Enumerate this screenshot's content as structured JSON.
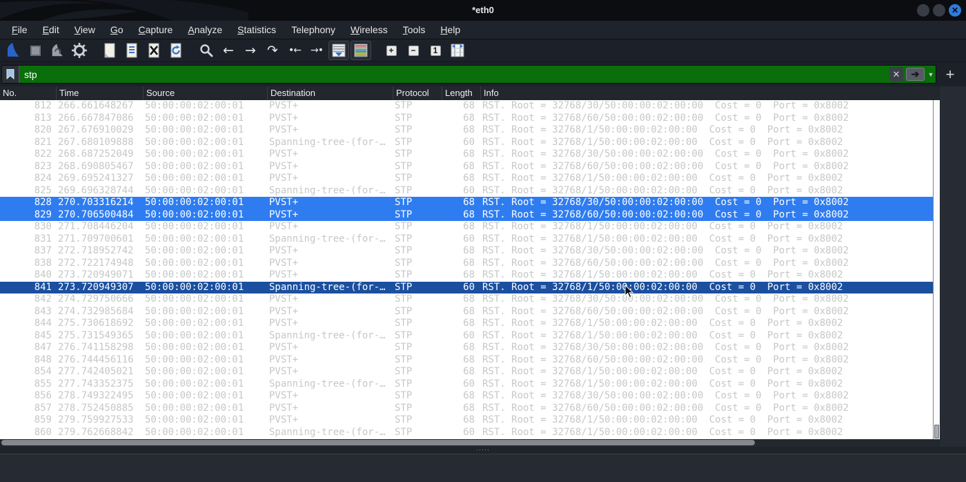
{
  "window": {
    "title": "*eth0",
    "controls": {
      "minimize": "",
      "maximize": "",
      "close": "✕"
    }
  },
  "menu_bar": {
    "items": [
      {
        "label": "File",
        "mnemonic": "F"
      },
      {
        "label": "Edit",
        "mnemonic": "E"
      },
      {
        "label": "View",
        "mnemonic": "V"
      },
      {
        "label": "Go",
        "mnemonic": "G"
      },
      {
        "label": "Capture",
        "mnemonic": "C"
      },
      {
        "label": "Analyze",
        "mnemonic": "A"
      },
      {
        "label": "Statistics",
        "mnemonic": "S"
      },
      {
        "label": "Telephony",
        "mnemonic": ""
      },
      {
        "label": "Wireless",
        "mnemonic": "W"
      },
      {
        "label": "Tools",
        "mnemonic": "T"
      },
      {
        "label": "Help",
        "mnemonic": "H"
      }
    ]
  },
  "toolbar": {
    "buttons": [
      {
        "name": "start-capture"
      },
      {
        "name": "stop-capture"
      },
      {
        "name": "restart-capture"
      },
      {
        "name": "capture-options"
      },
      {
        "name": "open-file"
      },
      {
        "name": "save-file"
      },
      {
        "name": "close-file"
      },
      {
        "name": "reload-file"
      },
      {
        "name": "find-packet"
      },
      {
        "name": "go-back",
        "glyph": "←"
      },
      {
        "name": "go-forward",
        "glyph": "→"
      },
      {
        "name": "go-to-packet",
        "glyph": "↷"
      },
      {
        "name": "go-first-packet",
        "glyph": "•←"
      },
      {
        "name": "go-last-packet",
        "glyph": "→•"
      },
      {
        "name": "auto-scroll",
        "pressed": true
      },
      {
        "name": "colorize",
        "pressed": true
      },
      {
        "name": "zoom-in",
        "glyph": "+"
      },
      {
        "name": "zoom-out",
        "glyph": "−"
      },
      {
        "name": "zoom-normal",
        "glyph": "1"
      },
      {
        "name": "resize-columns"
      }
    ]
  },
  "filter_bar": {
    "value": "stp",
    "bookmark_icon": "bookmark-icon",
    "clear_label": "✕",
    "apply_label": "➔",
    "dropdown_caret": "▼",
    "add_button_label": "+"
  },
  "packet_list": {
    "columns": [
      "No.",
      "Time",
      "Source",
      "Destination",
      "Protocol",
      "Length",
      "Info"
    ],
    "rows": [
      {
        "state": "normal",
        "no": "812",
        "time": "266.661648267",
        "source": "50:00:00:02:00:01",
        "destination": "PVST+",
        "protocol": "STP",
        "length": "68",
        "info": "RST. Root = 32768/30/50:00:00:02:00:00  Cost = 0  Port = 0x8002"
      },
      {
        "state": "normal",
        "no": "813",
        "time": "266.667847086",
        "source": "50:00:00:02:00:01",
        "destination": "PVST+",
        "protocol": "STP",
        "length": "68",
        "info": "RST. Root = 32768/60/50:00:00:02:00:00  Cost = 0  Port = 0x8002"
      },
      {
        "state": "normal",
        "no": "820",
        "time": "267.676910029",
        "source": "50:00:00:02:00:01",
        "destination": "PVST+",
        "protocol": "STP",
        "length": "68",
        "info": "RST. Root = 32768/1/50:00:00:02:00:00  Cost = 0  Port = 0x8002"
      },
      {
        "state": "normal",
        "no": "821",
        "time": "267.680109888",
        "source": "50:00:00:02:00:01",
        "destination": "Spanning-tree-(for-…",
        "protocol": "STP",
        "length": "60",
        "info": "RST. Root = 32768/1/50:00:00:02:00:00  Cost = 0  Port = 0x8002"
      },
      {
        "state": "normal",
        "no": "822",
        "time": "268.687252049",
        "source": "50:00:00:02:00:01",
        "destination": "PVST+",
        "protocol": "STP",
        "length": "68",
        "info": "RST. Root = 32768/30/50:00:00:02:00:00  Cost = 0  Port = 0x8002"
      },
      {
        "state": "normal",
        "no": "823",
        "time": "268.690805467",
        "source": "50:00:00:02:00:01",
        "destination": "PVST+",
        "protocol": "STP",
        "length": "68",
        "info": "RST. Root = 32768/60/50:00:00:02:00:00  Cost = 0  Port = 0x8002"
      },
      {
        "state": "normal",
        "no": "824",
        "time": "269.695241327",
        "source": "50:00:00:02:00:01",
        "destination": "PVST+",
        "protocol": "STP",
        "length": "68",
        "info": "RST. Root = 32768/1/50:00:00:02:00:00  Cost = 0  Port = 0x8002"
      },
      {
        "state": "normal",
        "no": "825",
        "time": "269.696328744",
        "source": "50:00:00:02:00:01",
        "destination": "Spanning-tree-(for-…",
        "protocol": "STP",
        "length": "60",
        "info": "RST. Root = 32768/1/50:00:00:02:00:00  Cost = 0  Port = 0x8002"
      },
      {
        "state": "selected",
        "no": "828",
        "time": "270.703316214",
        "source": "50:00:00:02:00:01",
        "destination": "PVST+",
        "protocol": "STP",
        "length": "68",
        "info": "RST. Root = 32768/30/50:00:00:02:00:00  Cost = 0  Port = 0x8002"
      },
      {
        "state": "selected",
        "no": "829",
        "time": "270.706500484",
        "source": "50:00:00:02:00:01",
        "destination": "PVST+",
        "protocol": "STP",
        "length": "68",
        "info": "RST. Root = 32768/60/50:00:00:02:00:00  Cost = 0  Port = 0x8002"
      },
      {
        "state": "normal",
        "no": "830",
        "time": "271.708446204",
        "source": "50:00:00:02:00:01",
        "destination": "PVST+",
        "protocol": "STP",
        "length": "68",
        "info": "RST. Root = 32768/1/50:00:00:02:00:00  Cost = 0  Port = 0x8002"
      },
      {
        "state": "normal",
        "no": "831",
        "time": "271.709700601",
        "source": "50:00:00:02:00:01",
        "destination": "Spanning-tree-(for-…",
        "protocol": "STP",
        "length": "60",
        "info": "RST. Root = 32768/1/50:00:00:02:00:00  Cost = 0  Port = 0x8002"
      },
      {
        "state": "normal",
        "no": "837",
        "time": "272.718952742",
        "source": "50:00:00:02:00:01",
        "destination": "PVST+",
        "protocol": "STP",
        "length": "68",
        "info": "RST. Root = 32768/30/50:00:00:02:00:00  Cost = 0  Port = 0x8002"
      },
      {
        "state": "normal",
        "no": "838",
        "time": "272.722174948",
        "source": "50:00:00:02:00:01",
        "destination": "PVST+",
        "protocol": "STP",
        "length": "68",
        "info": "RST. Root = 32768/60/50:00:00:02:00:00  Cost = 0  Port = 0x8002"
      },
      {
        "state": "normal",
        "no": "840",
        "time": "273.720949071",
        "source": "50:00:00:02:00:01",
        "destination": "PVST+",
        "protocol": "STP",
        "length": "68",
        "info": "RST. Root = 32768/1/50:00:00:02:00:00  Cost = 0  Port = 0x8002"
      },
      {
        "state": "focused",
        "no": "841",
        "time": "273.720949307",
        "source": "50:00:00:02:00:01",
        "destination": "Spanning-tree-(for-…",
        "protocol": "STP",
        "length": "60",
        "info": "RST. Root = 32768/1/50:00:00:02:00:00  Cost = 0  Port = 0x8002"
      },
      {
        "state": "normal",
        "no": "842",
        "time": "274.729750666",
        "source": "50:00:00:02:00:01",
        "destination": "PVST+",
        "protocol": "STP",
        "length": "68",
        "info": "RST. Root = 32768/30/50:00:00:02:00:00  Cost = 0  Port = 0x8002"
      },
      {
        "state": "normal",
        "no": "843",
        "time": "274.732985684",
        "source": "50:00:00:02:00:01",
        "destination": "PVST+",
        "protocol": "STP",
        "length": "68",
        "info": "RST. Root = 32768/60/50:00:00:02:00:00  Cost = 0  Port = 0x8002"
      },
      {
        "state": "normal",
        "no": "844",
        "time": "275.730618692",
        "source": "50:00:00:02:00:01",
        "destination": "PVST+",
        "protocol": "STP",
        "length": "68",
        "info": "RST. Root = 32768/1/50:00:00:02:00:00  Cost = 0  Port = 0x8002"
      },
      {
        "state": "normal",
        "no": "845",
        "time": "275.731549365",
        "source": "50:00:00:02:00:01",
        "destination": "Spanning-tree-(for-…",
        "protocol": "STP",
        "length": "60",
        "info": "RST. Root = 32768/1/50:00:00:02:00:00  Cost = 0  Port = 0x8002"
      },
      {
        "state": "normal",
        "no": "847",
        "time": "276.741158298",
        "source": "50:00:00:02:00:01",
        "destination": "PVST+",
        "protocol": "STP",
        "length": "68",
        "info": "RST. Root = 32768/30/50:00:00:02:00:00  Cost = 0  Port = 0x8002"
      },
      {
        "state": "normal",
        "no": "848",
        "time": "276.744456116",
        "source": "50:00:00:02:00:01",
        "destination": "PVST+",
        "protocol": "STP",
        "length": "68",
        "info": "RST. Root = 32768/60/50:00:00:02:00:00  Cost = 0  Port = 0x8002"
      },
      {
        "state": "normal",
        "no": "854",
        "time": "277.742405021",
        "source": "50:00:00:02:00:01",
        "destination": "PVST+",
        "protocol": "STP",
        "length": "68",
        "info": "RST. Root = 32768/1/50:00:00:02:00:00  Cost = 0  Port = 0x8002"
      },
      {
        "state": "normal",
        "no": "855",
        "time": "277.743352375",
        "source": "50:00:00:02:00:01",
        "destination": "Spanning-tree-(for-…",
        "protocol": "STP",
        "length": "60",
        "info": "RST. Root = 32768/1/50:00:00:02:00:00  Cost = 0  Port = 0x8002"
      },
      {
        "state": "normal",
        "no": "856",
        "time": "278.749322495",
        "source": "50:00:00:02:00:01",
        "destination": "PVST+",
        "protocol": "STP",
        "length": "68",
        "info": "RST. Root = 32768/30/50:00:00:02:00:00  Cost = 0  Port = 0x8002"
      },
      {
        "state": "normal",
        "no": "857",
        "time": "278.752450885",
        "source": "50:00:00:02:00:01",
        "destination": "PVST+",
        "protocol": "STP",
        "length": "68",
        "info": "RST. Root = 32768/60/50:00:00:02:00:00  Cost = 0  Port = 0x8002"
      },
      {
        "state": "normal",
        "no": "859",
        "time": "279.759927533",
        "source": "50:00:00:02:00:01",
        "destination": "PVST+",
        "protocol": "STP",
        "length": "68",
        "info": "RST. Root = 32768/1/50:00:00:02:00:00  Cost = 0  Port = 0x8002"
      },
      {
        "state": "normal",
        "no": "860",
        "time": "279.762668842",
        "source": "50:00:00:02:00:01",
        "destination": "Spanning-tree-(for-…",
        "protocol": "STP",
        "length": "60",
        "info": "RST. Root = 32768/1/50:00:00:02:00:00  Cost = 0  Port = 0x8002"
      }
    ]
  },
  "splitter_dots": "·····",
  "colors": {
    "filter_valid_bg": "#0a6e0a",
    "selection_blue": "#2e7cf0",
    "focused_row_blue": "#1b4f9f",
    "row_text_gray": "#c5c8c5",
    "close_button_blue": "#2e7bdc",
    "titlebar_bg": "#0b0d11",
    "chrome_bg": "#1c2028"
  }
}
